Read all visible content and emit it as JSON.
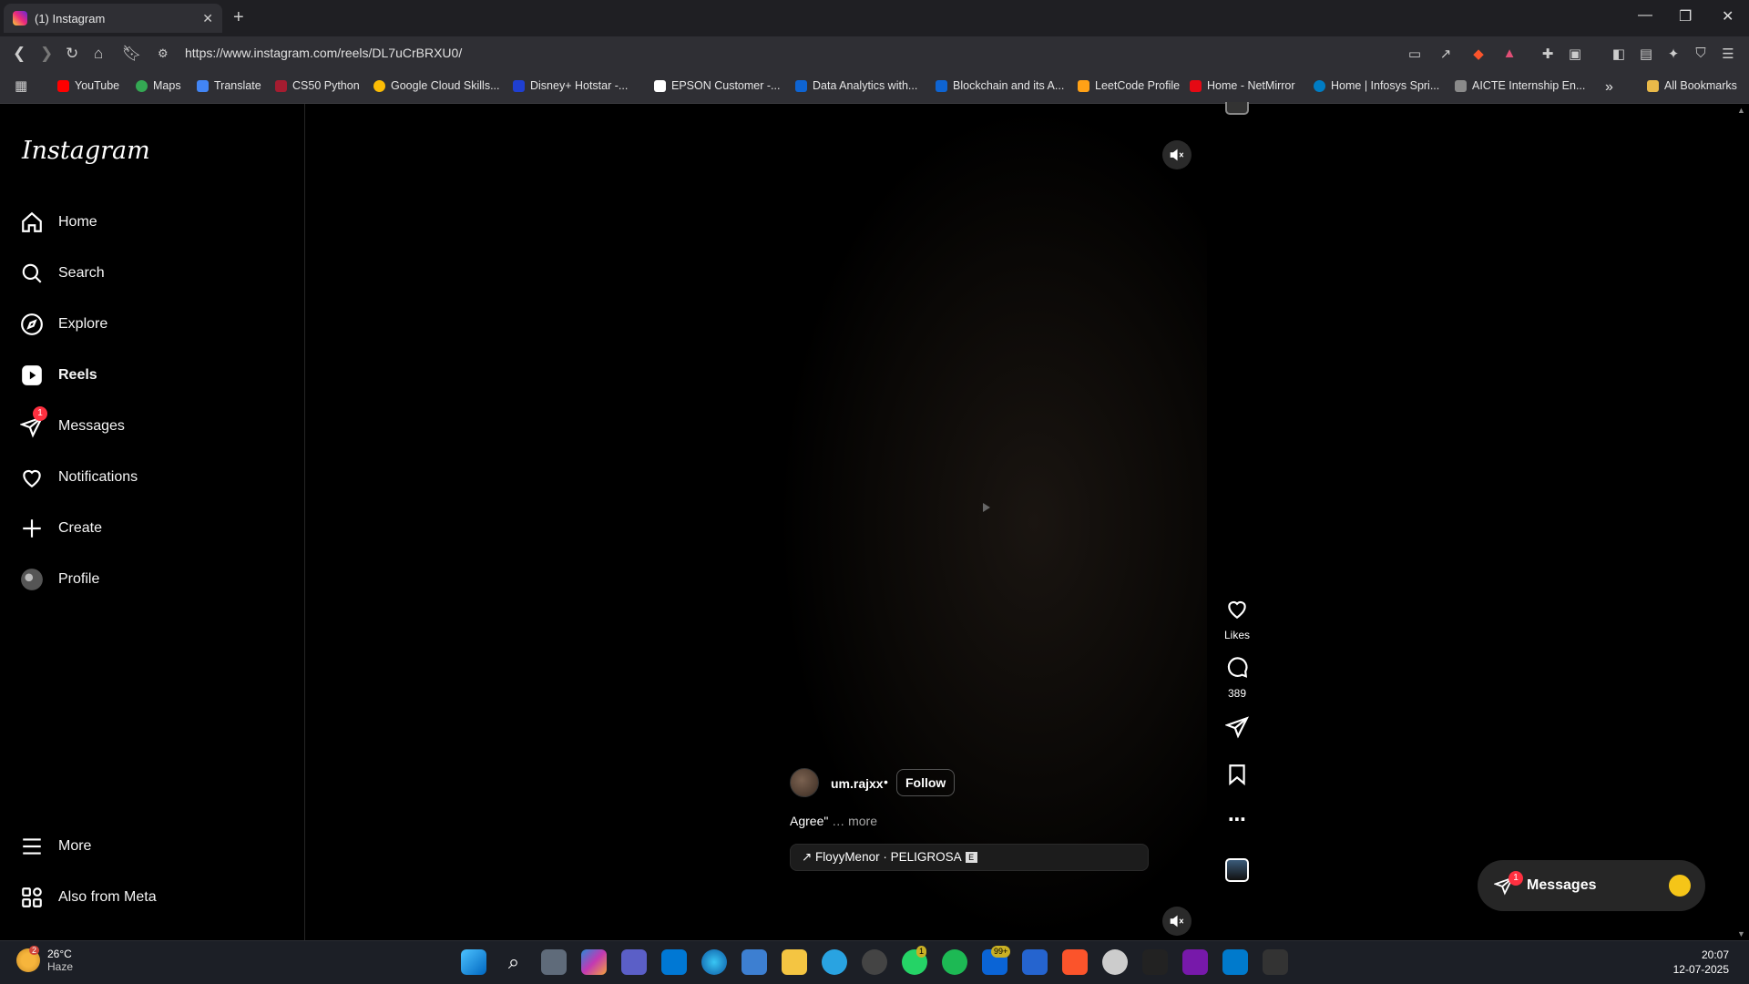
{
  "browser": {
    "tab_title": "(1) Instagram",
    "url": "https://www.instagram.com/reels/DL7uCrBRXU0/",
    "bookmarks": [
      "YouTube",
      "Maps",
      "Translate",
      "CS50 Python",
      "Google Cloud Skills...",
      "Disney+ Hotstar -...",
      "EPSON Customer -...",
      "Data Analytics with...",
      "Blockchain and its A...",
      "LeetCode Profile",
      "Home - NetMirror",
      "Home | Infosys Spri...",
      "AICTE Internship En..."
    ],
    "all_bookmarks": "All Bookmarks",
    "more_bookmarks": "»"
  },
  "sidebar": {
    "logo": "Instagram",
    "items": [
      {
        "label": "Home",
        "icon": "home-icon"
      },
      {
        "label": "Search",
        "icon": "search-icon"
      },
      {
        "label": "Explore",
        "icon": "explore-icon"
      },
      {
        "label": "Reels",
        "icon": "reels-icon"
      },
      {
        "label": "Messages",
        "icon": "messages-icon",
        "badge": "1"
      },
      {
        "label": "Notifications",
        "icon": "heart-icon"
      },
      {
        "label": "Create",
        "icon": "plus-icon"
      },
      {
        "label": "Profile",
        "icon": "avatar-icon"
      }
    ],
    "more": "More",
    "also_from_meta": "Also from Meta"
  },
  "reel": {
    "username": "um.rajxx",
    "dot": "•",
    "follow": "Follow",
    "caption": "Agree\"",
    "caption_more": "… more",
    "audio": "↗ FloyyMenor · PELIGROSA",
    "audio_badge": "E",
    "likes_label": "Likes",
    "comments_count": "389"
  },
  "messages_pill": {
    "label": "Messages",
    "badge": "1"
  },
  "taskbar": {
    "temperature": "26°C",
    "condition": "Haze",
    "weather_badge": "2",
    "time": "20:07",
    "date": "12-07-2025",
    "whatsapp_badge": "1",
    "mail_badge": "99+"
  },
  "colors": {
    "badge": "#ff3040",
    "background": "#000000",
    "pill": "#262626"
  }
}
